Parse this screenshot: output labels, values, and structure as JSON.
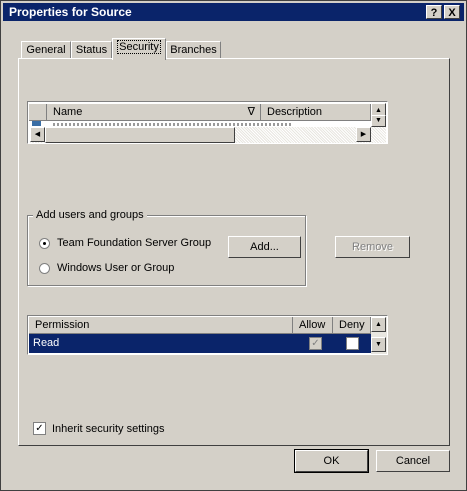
{
  "window": {
    "title": "Properties for Source",
    "help_button": "?",
    "close_button": "X"
  },
  "tabs": [
    {
      "label": "General",
      "active": false
    },
    {
      "label": "Status",
      "active": false
    },
    {
      "label": "Security",
      "active": true
    },
    {
      "label": "Branches",
      "active": false
    }
  ],
  "users_list": {
    "columns": [
      "Name",
      "Description"
    ],
    "sort_indicator": "∇"
  },
  "add_group": {
    "legend": "Add users and groups",
    "options": [
      {
        "label": "Team Foundation Server Group",
        "selected": true
      },
      {
        "label": "Windows User or Group",
        "selected": false
      }
    ],
    "add_button": "Add...",
    "remove_button": "Remove"
  },
  "permissions": {
    "columns": [
      "Permission",
      "Allow",
      "Deny"
    ],
    "rows": [
      {
        "name": "Read",
        "allow": true,
        "allow_disabled": true,
        "deny": false
      }
    ]
  },
  "inherit": {
    "label": "Inherit security settings",
    "checked": true
  },
  "footer": {
    "ok_label": "OK",
    "cancel_label": "Cancel"
  },
  "colors": {
    "dialog_face": "#d4d0c8",
    "titlebar": "#0a246a",
    "selection": "#0a246a"
  }
}
